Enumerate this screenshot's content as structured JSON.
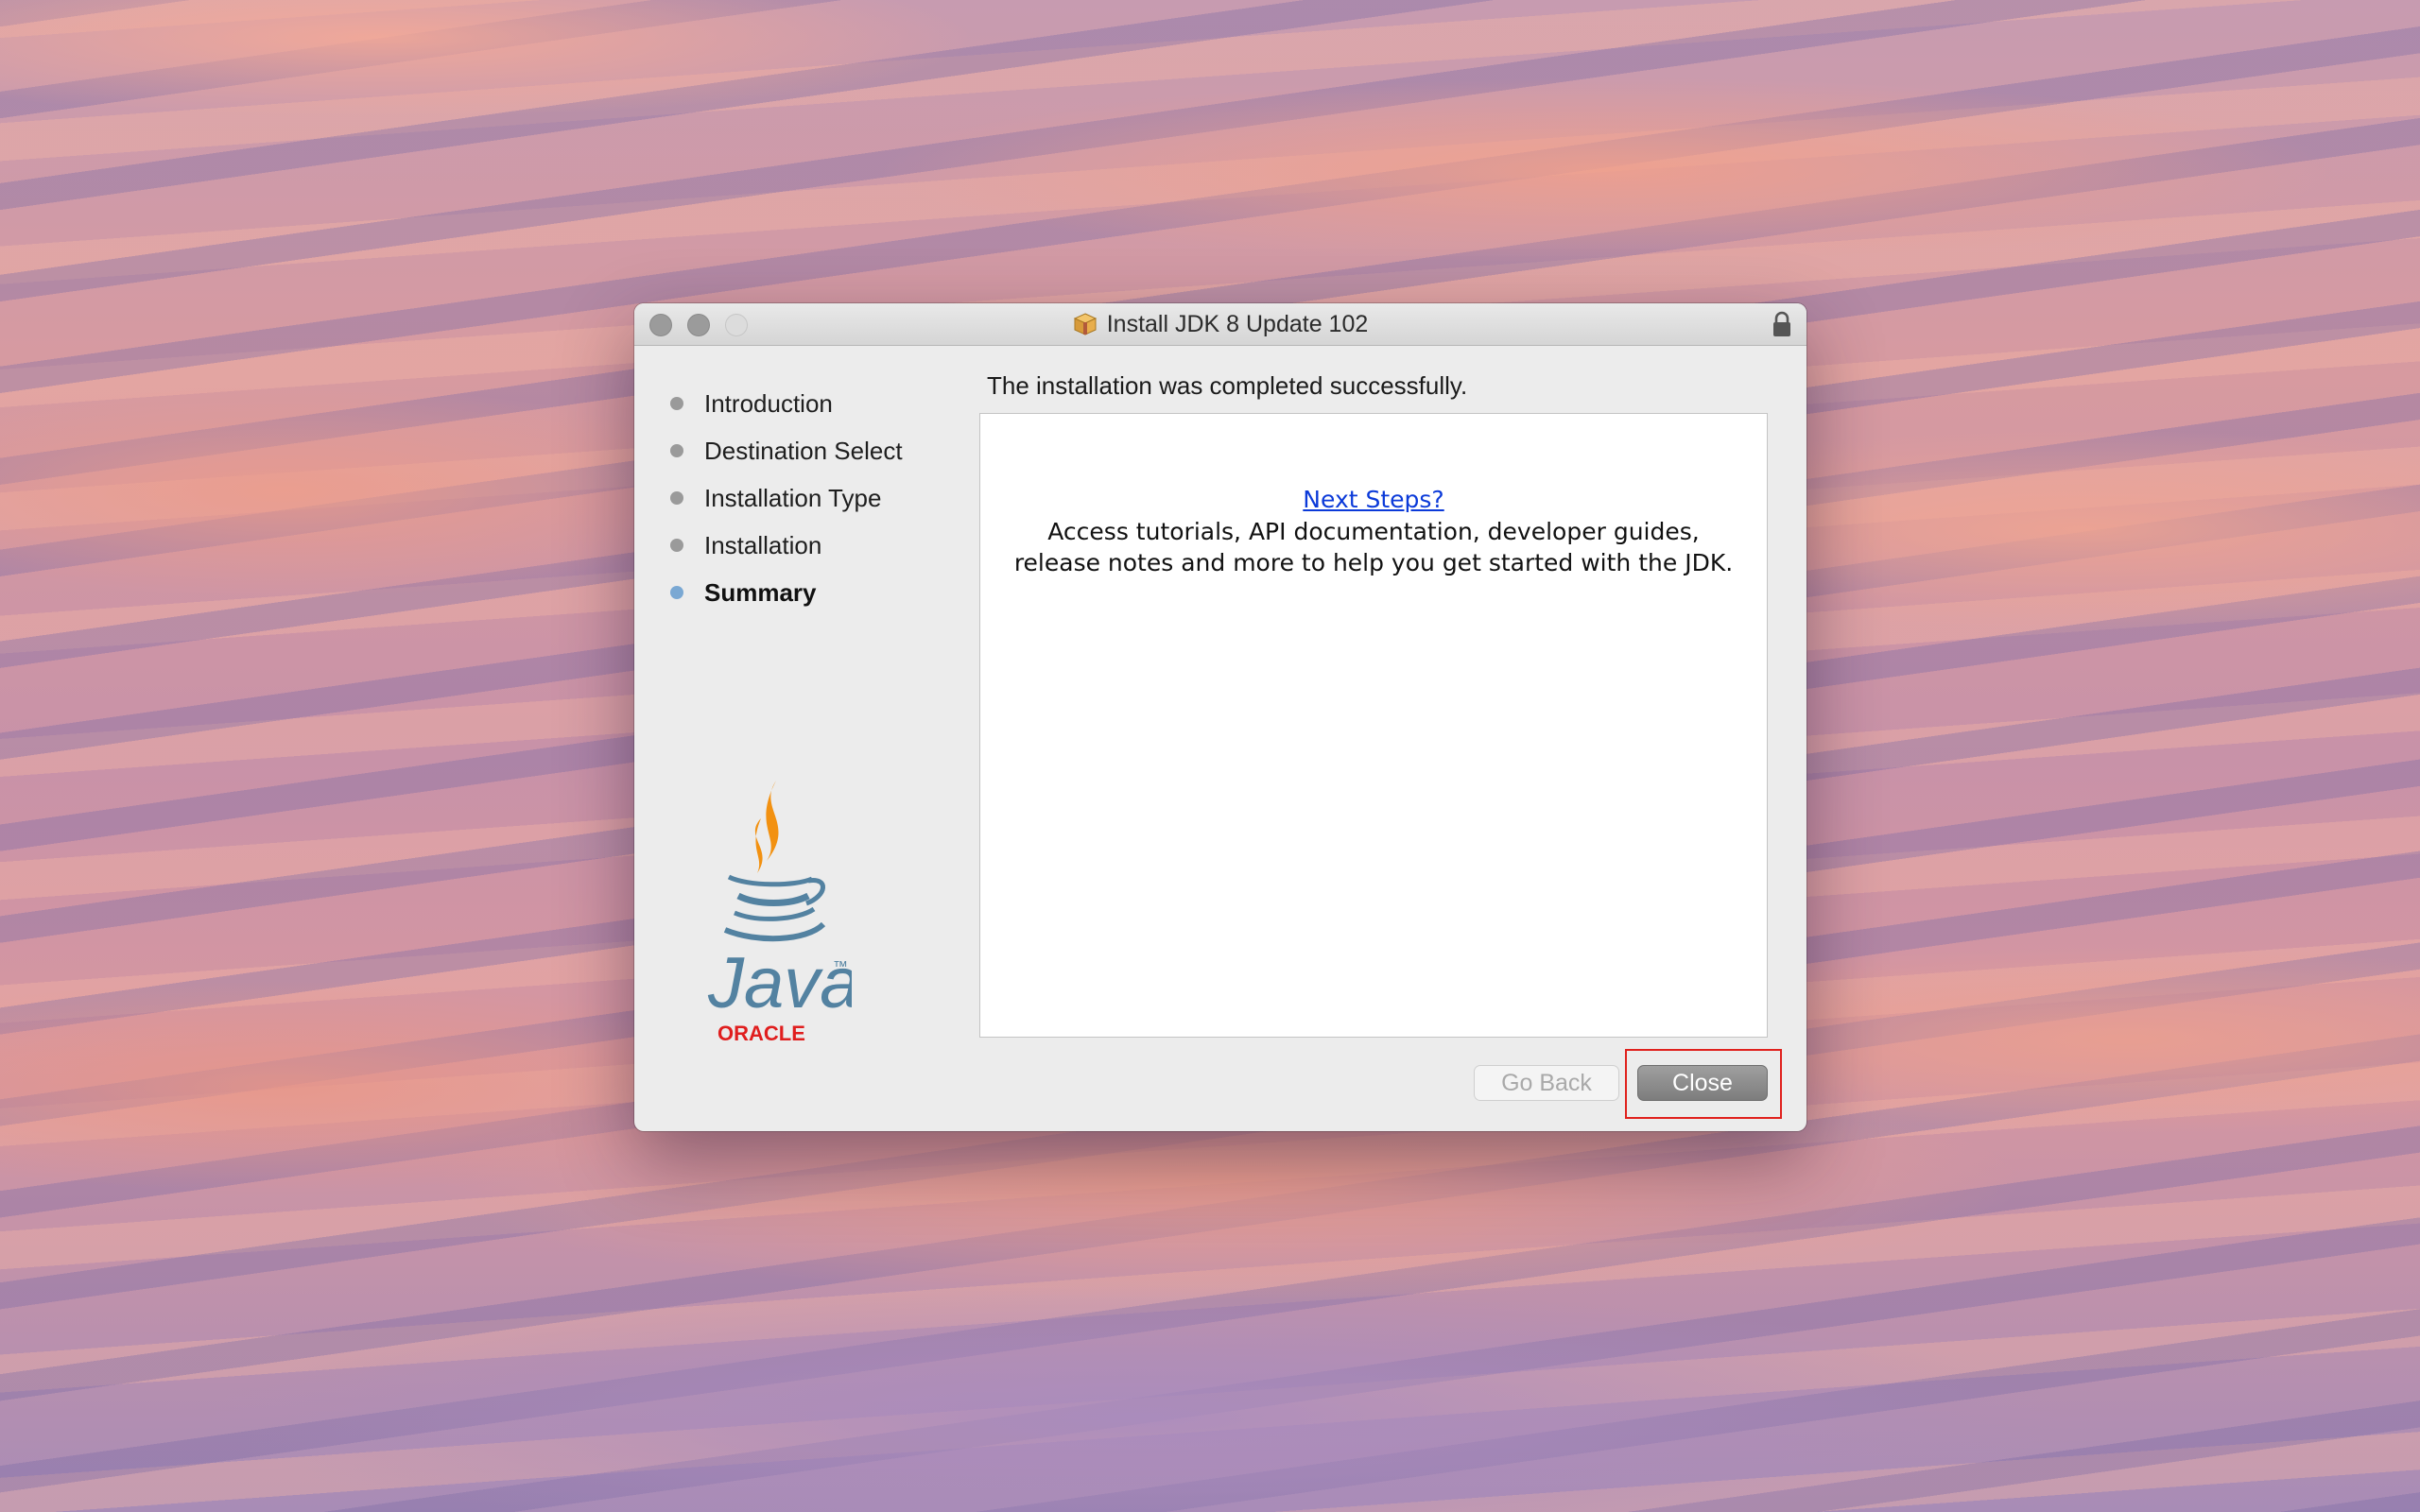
{
  "window": {
    "title": "Install JDK 8 Update 102"
  },
  "sidebar": {
    "steps": [
      {
        "label": "Introduction",
        "active": false
      },
      {
        "label": "Destination Select",
        "active": false
      },
      {
        "label": "Installation Type",
        "active": false
      },
      {
        "label": "Installation",
        "active": false
      },
      {
        "label": "Summary",
        "active": true
      }
    ],
    "logo": {
      "wordmark": "Java",
      "trademark": "™",
      "brand": "ORACLE"
    }
  },
  "main": {
    "heading": "The installation was completed successfully.",
    "next_steps_link": "Next Steps?",
    "next_steps_desc": "Access tutorials, API documentation, developer guides, release notes and more to help you get started with the JDK."
  },
  "buttons": {
    "go_back": "Go Back",
    "close": "Close"
  },
  "colors": {
    "active_step_dot": "#7aa8d3",
    "link": "#0b3ad9",
    "highlight": "#e0211d",
    "java_blue": "#5382a1",
    "java_orange": "#f29111",
    "oracle_red": "#e01e1e"
  }
}
